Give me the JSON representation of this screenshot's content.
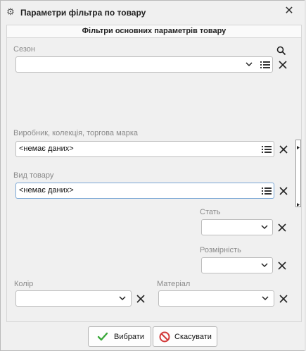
{
  "window": {
    "title": "Параметри фільтра по товару",
    "close_icon": "close-icon",
    "app_icon": "gear-icon"
  },
  "panel": {
    "header": "Фільтри основних параметрів товару"
  },
  "fields": {
    "season": {
      "label": "Сезон",
      "value": ""
    },
    "manufacturer": {
      "label": "Виробник, колекція, торгова марка",
      "value": "<немає даних>"
    },
    "product_type": {
      "label": "Вид товару",
      "value": "<немає даних>"
    },
    "gender": {
      "label": "Стать",
      "value": ""
    },
    "size_grid": {
      "label": "Розмірність",
      "value": ""
    },
    "color": {
      "label": "Колір",
      "value": ""
    },
    "material": {
      "label": "Матеріал",
      "value": ""
    }
  },
  "buttons": {
    "select_label": "Вибрати",
    "cancel_label": "Скасувати"
  },
  "colors": {
    "accent_green": "#3aa83a",
    "cancel_red": "#d23a3a",
    "focus_border": "#7aa7d6"
  }
}
